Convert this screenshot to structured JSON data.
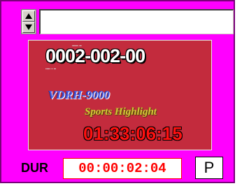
{
  "clip_selector": {
    "value": "",
    "placeholder": ""
  },
  "preview": {
    "clip_id": "0002-002-00",
    "source_tape": "VDRH-9000",
    "program_title": "Sports Highlight",
    "timecode": "01:33:06:15"
  },
  "duration": {
    "label": "DUR",
    "value": "00:00:02:04"
  },
  "controls": {
    "p_button_label": "P"
  },
  "icons": {
    "spin_up": "arrow-up-icon",
    "spin_down": "arrow-down-icon"
  },
  "colors": {
    "frame": "#ff00ff",
    "preview_background": "#c32b3d",
    "timecode": "#ff1010",
    "duration_text": "#ff0000"
  }
}
